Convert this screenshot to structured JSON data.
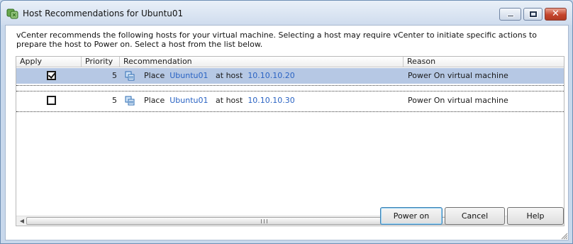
{
  "window": {
    "title": "Host Recommendations for Ubuntu01"
  },
  "description": "vCenter recommends the following hosts for your virtual machine. Selecting a host may require vCenter to initiate specific actions to prepare the host to Power on. Select a host from the list below.",
  "table": {
    "columns": [
      "Apply",
      "Priority",
      "Recommendation",
      "Reason"
    ],
    "rows": [
      {
        "apply": true,
        "selected": true,
        "priority": "5",
        "place": "Place",
        "vm": "Ubuntu01",
        "at_host": "at host",
        "host": "10.10.10.20",
        "reason": "Power On virtual machine"
      },
      {
        "apply": false,
        "selected": false,
        "priority": "5",
        "place": "Place",
        "vm": "Ubuntu01",
        "at_host": "at host",
        "host": "10.10.10.30",
        "reason": "Power On virtual machine"
      }
    ]
  },
  "buttons": {
    "power_on": "Power on",
    "cancel": "Cancel",
    "help": "Help"
  },
  "icons": [
    "vcenter-app-icon",
    "minimize-icon",
    "maximize-icon",
    "close-icon",
    "host-vm-icon",
    "scroll-left-icon",
    "scroll-right-icon",
    "resize-grip-icon"
  ],
  "colors": {
    "link": "#2a63c3",
    "selection": "#b6c8e4"
  }
}
